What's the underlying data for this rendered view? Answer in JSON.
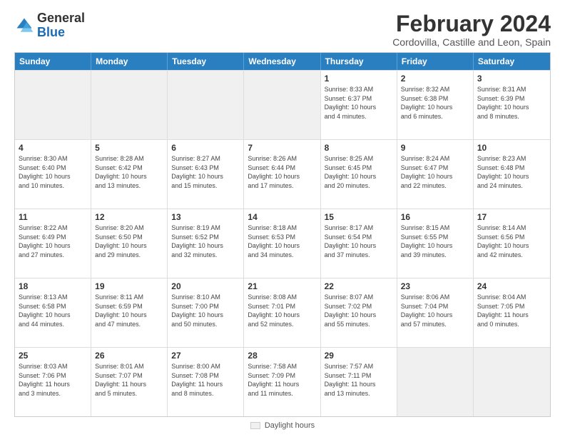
{
  "logo": {
    "general": "General",
    "blue": "Blue"
  },
  "header": {
    "month": "February 2024",
    "location": "Cordovilla, Castille and Leon, Spain"
  },
  "days_of_week": [
    "Sunday",
    "Monday",
    "Tuesday",
    "Wednesday",
    "Thursday",
    "Friday",
    "Saturday"
  ],
  "weeks": [
    [
      {
        "day": "",
        "info": "",
        "empty": true
      },
      {
        "day": "",
        "info": "",
        "empty": true
      },
      {
        "day": "",
        "info": "",
        "empty": true
      },
      {
        "day": "",
        "info": "",
        "empty": true
      },
      {
        "day": "1",
        "info": "Sunrise: 8:33 AM\nSunset: 6:37 PM\nDaylight: 10 hours\nand 4 minutes."
      },
      {
        "day": "2",
        "info": "Sunrise: 8:32 AM\nSunset: 6:38 PM\nDaylight: 10 hours\nand 6 minutes."
      },
      {
        "day": "3",
        "info": "Sunrise: 8:31 AM\nSunset: 6:39 PM\nDaylight: 10 hours\nand 8 minutes."
      }
    ],
    [
      {
        "day": "4",
        "info": "Sunrise: 8:30 AM\nSunset: 6:40 PM\nDaylight: 10 hours\nand 10 minutes."
      },
      {
        "day": "5",
        "info": "Sunrise: 8:28 AM\nSunset: 6:42 PM\nDaylight: 10 hours\nand 13 minutes."
      },
      {
        "day": "6",
        "info": "Sunrise: 8:27 AM\nSunset: 6:43 PM\nDaylight: 10 hours\nand 15 minutes."
      },
      {
        "day": "7",
        "info": "Sunrise: 8:26 AM\nSunset: 6:44 PM\nDaylight: 10 hours\nand 17 minutes."
      },
      {
        "day": "8",
        "info": "Sunrise: 8:25 AM\nSunset: 6:45 PM\nDaylight: 10 hours\nand 20 minutes."
      },
      {
        "day": "9",
        "info": "Sunrise: 8:24 AM\nSunset: 6:47 PM\nDaylight: 10 hours\nand 22 minutes."
      },
      {
        "day": "10",
        "info": "Sunrise: 8:23 AM\nSunset: 6:48 PM\nDaylight: 10 hours\nand 24 minutes."
      }
    ],
    [
      {
        "day": "11",
        "info": "Sunrise: 8:22 AM\nSunset: 6:49 PM\nDaylight: 10 hours\nand 27 minutes."
      },
      {
        "day": "12",
        "info": "Sunrise: 8:20 AM\nSunset: 6:50 PM\nDaylight: 10 hours\nand 29 minutes."
      },
      {
        "day": "13",
        "info": "Sunrise: 8:19 AM\nSunset: 6:52 PM\nDaylight: 10 hours\nand 32 minutes."
      },
      {
        "day": "14",
        "info": "Sunrise: 8:18 AM\nSunset: 6:53 PM\nDaylight: 10 hours\nand 34 minutes."
      },
      {
        "day": "15",
        "info": "Sunrise: 8:17 AM\nSunset: 6:54 PM\nDaylight: 10 hours\nand 37 minutes."
      },
      {
        "day": "16",
        "info": "Sunrise: 8:15 AM\nSunset: 6:55 PM\nDaylight: 10 hours\nand 39 minutes."
      },
      {
        "day": "17",
        "info": "Sunrise: 8:14 AM\nSunset: 6:56 PM\nDaylight: 10 hours\nand 42 minutes."
      }
    ],
    [
      {
        "day": "18",
        "info": "Sunrise: 8:13 AM\nSunset: 6:58 PM\nDaylight: 10 hours\nand 44 minutes."
      },
      {
        "day": "19",
        "info": "Sunrise: 8:11 AM\nSunset: 6:59 PM\nDaylight: 10 hours\nand 47 minutes."
      },
      {
        "day": "20",
        "info": "Sunrise: 8:10 AM\nSunset: 7:00 PM\nDaylight: 10 hours\nand 50 minutes."
      },
      {
        "day": "21",
        "info": "Sunrise: 8:08 AM\nSunset: 7:01 PM\nDaylight: 10 hours\nand 52 minutes."
      },
      {
        "day": "22",
        "info": "Sunrise: 8:07 AM\nSunset: 7:02 PM\nDaylight: 10 hours\nand 55 minutes."
      },
      {
        "day": "23",
        "info": "Sunrise: 8:06 AM\nSunset: 7:04 PM\nDaylight: 10 hours\nand 57 minutes."
      },
      {
        "day": "24",
        "info": "Sunrise: 8:04 AM\nSunset: 7:05 PM\nDaylight: 11 hours\nand 0 minutes."
      }
    ],
    [
      {
        "day": "25",
        "info": "Sunrise: 8:03 AM\nSunset: 7:06 PM\nDaylight: 11 hours\nand 3 minutes."
      },
      {
        "day": "26",
        "info": "Sunrise: 8:01 AM\nSunset: 7:07 PM\nDaylight: 11 hours\nand 5 minutes."
      },
      {
        "day": "27",
        "info": "Sunrise: 8:00 AM\nSunset: 7:08 PM\nDaylight: 11 hours\nand 8 minutes."
      },
      {
        "day": "28",
        "info": "Sunrise: 7:58 AM\nSunset: 7:09 PM\nDaylight: 11 hours\nand 11 minutes."
      },
      {
        "day": "29",
        "info": "Sunrise: 7:57 AM\nSunset: 7:11 PM\nDaylight: 11 hours\nand 13 minutes."
      },
      {
        "day": "",
        "info": "",
        "empty": true
      },
      {
        "day": "",
        "info": "",
        "empty": true
      }
    ]
  ],
  "footer": {
    "legend_label": "Daylight hours"
  }
}
